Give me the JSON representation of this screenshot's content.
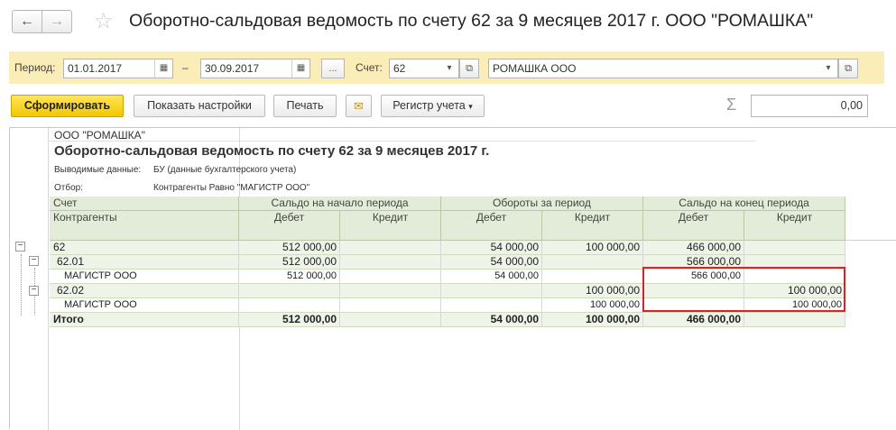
{
  "window": {
    "title": "Оборотно-сальдовая ведомость по счету 62 за 9 месяцев 2017 г. ООО \"РОМАШКА\"",
    "back_icon": "←",
    "forward_icon": "→",
    "star_icon": "☆"
  },
  "params": {
    "period_label": "Период:",
    "period_from": "01.01.2017",
    "period_dash": "–",
    "period_to": "30.09.2017",
    "period_more": "...",
    "account_label": "Счет:",
    "account_value": "62",
    "org_value": "РОМАШКА ООО"
  },
  "toolbar": {
    "generate": "Сформировать",
    "show_settings": "Показать настройки",
    "print": "Печать",
    "register": "Регистр учета",
    "sum_value": "0,00",
    "sigma": "Σ"
  },
  "report": {
    "org": "ООО \"РОМАШКА\"",
    "title": "Оборотно-сальдовая ведомость по счету 62 за 9 месяцев 2017 г.",
    "output_label": "Выводимые данные:",
    "output_value": "БУ (данные бухгалтерского учета)",
    "filter_label": "Отбор:",
    "filter_value": "Контрагенты Равно \"МАГИСТР ООО\"",
    "headers": {
      "account": "Счет",
      "counterparties": "Контрагенты",
      "opening": "Сальдо на начало периода",
      "turnover": "Обороты за период",
      "closing": "Сальдо на конец периода",
      "debit": "Дебет",
      "credit": "Кредит"
    },
    "rows": [
      {
        "name": "62",
        "values": [
          "512 000,00",
          "",
          "54 000,00",
          "100 000,00",
          "466 000,00",
          ""
        ]
      },
      {
        "name": "62.01",
        "values": [
          "512 000,00",
          "",
          "54 000,00",
          "",
          "566 000,00",
          ""
        ]
      },
      {
        "name": "МАГИСТР ООО",
        "values": [
          "512 000,00",
          "",
          "54 000,00",
          "",
          "566 000,00",
          ""
        ]
      },
      {
        "name": "62.02",
        "values": [
          "",
          "",
          "",
          "100 000,00",
          "",
          "100 000,00"
        ]
      },
      {
        "name": "МАГИСТР ООО",
        "values": [
          "",
          "",
          "",
          "100 000,00",
          "",
          "100 000,00"
        ]
      }
    ],
    "total": {
      "name": "Итого",
      "values": [
        "512 000,00",
        "",
        "54 000,00",
        "100 000,00",
        "466 000,00",
        ""
      ]
    }
  }
}
